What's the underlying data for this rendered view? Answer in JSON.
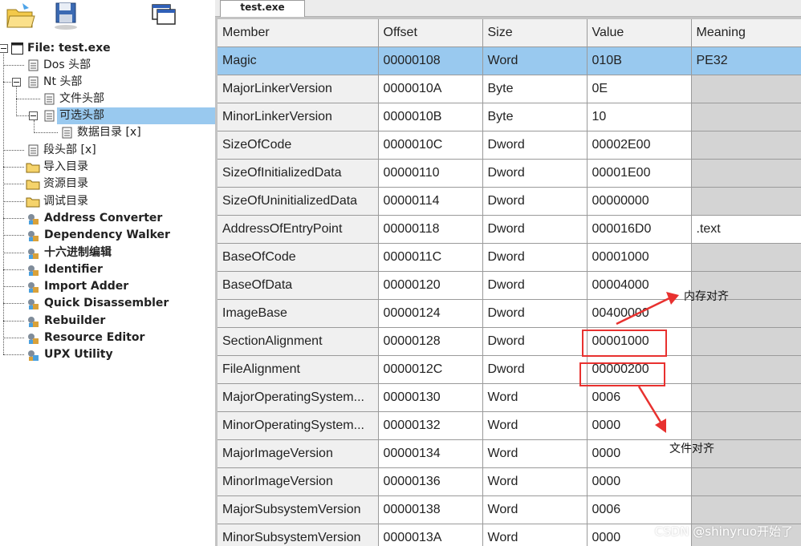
{
  "tab": {
    "label": "test.exe"
  },
  "tree": {
    "items": [
      {
        "label": "File: test.exe",
        "bold": true,
        "icon": "window-icon"
      },
      {
        "label": "Dos 头部",
        "icon": "document-icon"
      },
      {
        "label": "Nt 头部",
        "icon": "document-icon"
      },
      {
        "label": "文件头部",
        "icon": "document-icon"
      },
      {
        "label": "可选头部",
        "icon": "document-icon",
        "selected": true
      },
      {
        "label": "数据目录 [x]",
        "icon": "document-icon"
      },
      {
        "label": "段头部 [x]",
        "icon": "document-icon"
      },
      {
        "label": "导入目录",
        "icon": "folder-icon"
      },
      {
        "label": "资源目录",
        "icon": "folder-icon"
      },
      {
        "label": "调试目录",
        "icon": "folder-icon"
      },
      {
        "label": "Address Converter",
        "icon": "tool-icon",
        "bold": true
      },
      {
        "label": "Dependency Walker",
        "icon": "tool-icon",
        "bold": true
      },
      {
        "label": "十六进制编辑",
        "icon": "tool-icon",
        "bold": true
      },
      {
        "label": "Identifier",
        "icon": "tool-icon",
        "bold": true
      },
      {
        "label": "Import Adder",
        "icon": "tool-icon",
        "bold": true
      },
      {
        "label": "Quick Disassembler",
        "icon": "tool-icon",
        "bold": true
      },
      {
        "label": "Rebuilder",
        "icon": "tool-icon",
        "bold": true
      },
      {
        "label": "Resource Editor",
        "icon": "tool-icon",
        "bold": true
      },
      {
        "label": "UPX Utility",
        "icon": "tool-icon",
        "bold": true
      }
    ]
  },
  "table": {
    "columns": [
      "Member",
      "Offset",
      "Size",
      "Value",
      "Meaning"
    ],
    "rows": [
      {
        "member": "Magic",
        "offset": "00000108",
        "size": "Word",
        "value": "010B",
        "meaning": "PE32",
        "selected": true
      },
      {
        "member": "MajorLinkerVersion",
        "offset": "0000010A",
        "size": "Byte",
        "value": "0E",
        "meaning": ""
      },
      {
        "member": "MinorLinkerVersion",
        "offset": "0000010B",
        "size": "Byte",
        "value": "10",
        "meaning": ""
      },
      {
        "member": "SizeOfCode",
        "offset": "0000010C",
        "size": "Dword",
        "value": "00002E00",
        "meaning": ""
      },
      {
        "member": "SizeOfInitializedData",
        "offset": "00000110",
        "size": "Dword",
        "value": "00001E00",
        "meaning": ""
      },
      {
        "member": "SizeOfUninitializedData",
        "offset": "00000114",
        "size": "Dword",
        "value": "00000000",
        "meaning": ""
      },
      {
        "member": "AddressOfEntryPoint",
        "offset": "00000118",
        "size": "Dword",
        "value": "000016D0",
        "meaning": ".text"
      },
      {
        "member": "BaseOfCode",
        "offset": "0000011C",
        "size": "Dword",
        "value": "00001000",
        "meaning": ""
      },
      {
        "member": "BaseOfData",
        "offset": "00000120",
        "size": "Dword",
        "value": "00004000",
        "meaning": ""
      },
      {
        "member": "ImageBase",
        "offset": "00000124",
        "size": "Dword",
        "value": "00400000",
        "meaning": ""
      },
      {
        "member": "SectionAlignment",
        "offset": "00000128",
        "size": "Dword",
        "value": "00001000",
        "meaning": ""
      },
      {
        "member": "FileAlignment",
        "offset": "0000012C",
        "size": "Dword",
        "value": "00000200",
        "meaning": ""
      },
      {
        "member": "MajorOperatingSystem...",
        "offset": "00000130",
        "size": "Word",
        "value": "0006",
        "meaning": ""
      },
      {
        "member": "MinorOperatingSystem...",
        "offset": "00000132",
        "size": "Word",
        "value": "0000",
        "meaning": ""
      },
      {
        "member": "MajorImageVersion",
        "offset": "00000134",
        "size": "Word",
        "value": "0000",
        "meaning": ""
      },
      {
        "member": "MinorImageVersion",
        "offset": "00000136",
        "size": "Word",
        "value": "0000",
        "meaning": ""
      },
      {
        "member": "MajorSubsystemVersion",
        "offset": "00000138",
        "size": "Word",
        "value": "0006",
        "meaning": ""
      },
      {
        "member": "MinorSubsystemVersion",
        "offset": "0000013A",
        "size": "Word",
        "value": "0000",
        "meaning": ""
      }
    ]
  },
  "annotations": {
    "memory_align": "内存对齐",
    "file_align": "文件对齐"
  },
  "watermark": "CSDN @shinyruo开始了",
  "colors": {
    "selection": "#99c9ef",
    "annotation_red": "#e8312f",
    "empty_meaning_bg": "#d4d4d4",
    "pane_bg": "#c3c3c3"
  }
}
